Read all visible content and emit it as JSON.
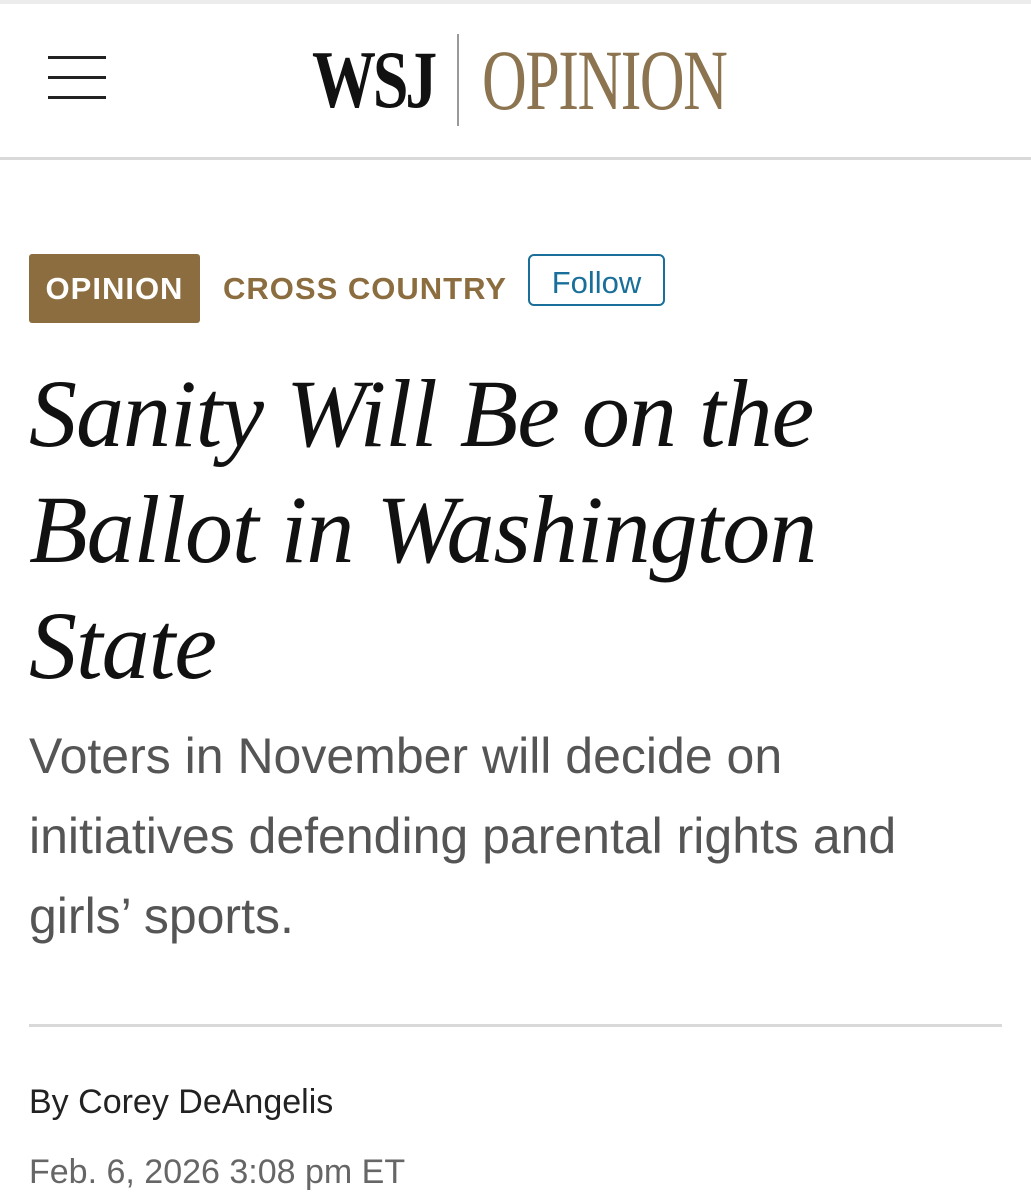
{
  "header": {
    "menu_icon": "hamburger-menu-icon",
    "logo": {
      "brand": "WSJ",
      "section": "OPINION"
    }
  },
  "article": {
    "tag": "OPINION",
    "section": "CROSS COUNTRY",
    "follow_label": "Follow",
    "headline": "Sanity Will Be on the Ballot in Washington State",
    "dek": "Voters in November will decide on initiatives defending parental rights and girls’ sports.",
    "byline_prefix": "By",
    "author": "Corey DeAngelis",
    "timestamp": "Feb. 6, 2026 3:08 pm ET"
  },
  "colors": {
    "accent": "#8c6d3f",
    "follow": "#1a6f9a",
    "text": "#111111",
    "muted": "#555555"
  }
}
